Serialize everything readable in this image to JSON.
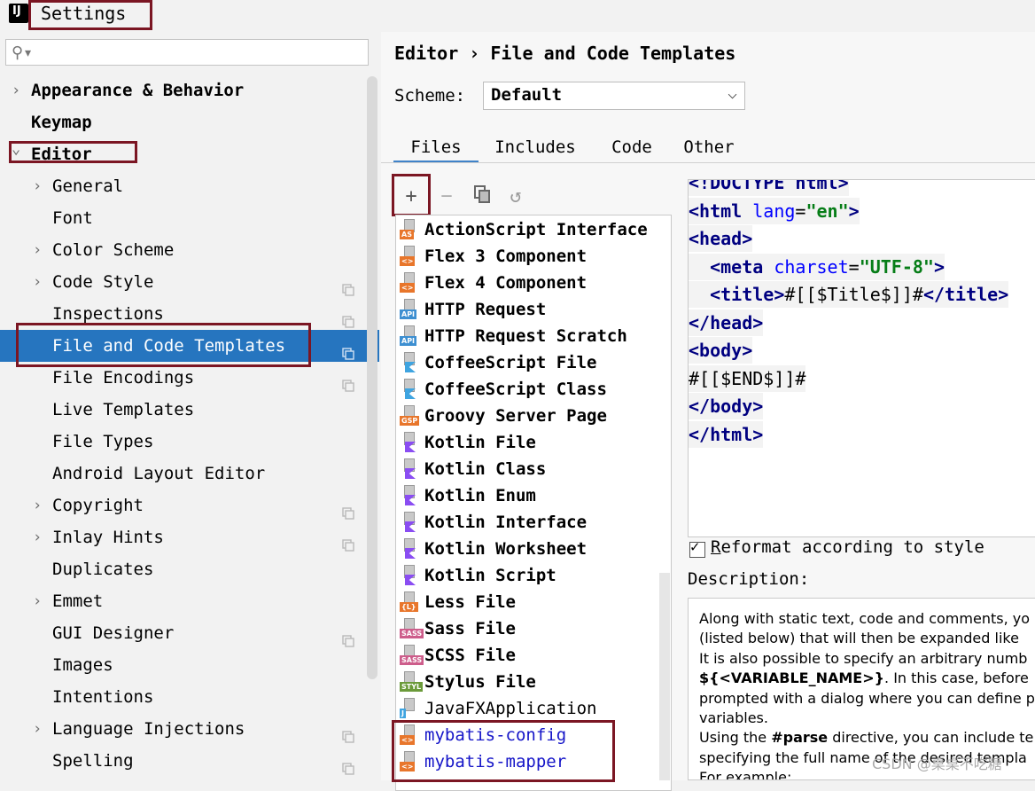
{
  "window": {
    "title": "Settings",
    "icon": "intellij-idea-icon"
  },
  "sidebar": {
    "search": {
      "placeholder": "",
      "icon": "search-icon"
    },
    "items": [
      {
        "label": "Appearance & Behavior",
        "expandable": true,
        "bold": true
      },
      {
        "label": "Keymap",
        "bold": true
      },
      {
        "label": "Editor",
        "expanded": true,
        "bold": true
      },
      {
        "label": "General",
        "expandable": true
      },
      {
        "label": "Font"
      },
      {
        "label": "Color Scheme",
        "expandable": true
      },
      {
        "label": "Code Style",
        "expandable": true,
        "project_icon": true
      },
      {
        "label": "Inspections",
        "project_icon": true
      },
      {
        "label": "File and Code Templates",
        "selected": true,
        "project_icon": true
      },
      {
        "label": "File Encodings",
        "project_icon": true
      },
      {
        "label": "Live Templates"
      },
      {
        "label": "File Types"
      },
      {
        "label": "Android Layout Editor"
      },
      {
        "label": "Copyright",
        "expandable": true,
        "project_icon": true
      },
      {
        "label": "Inlay Hints",
        "expandable": true,
        "project_icon": true
      },
      {
        "label": "Duplicates"
      },
      {
        "label": "Emmet",
        "expandable": true
      },
      {
        "label": "GUI Designer",
        "project_icon": true
      },
      {
        "label": "Images"
      },
      {
        "label": "Intentions"
      },
      {
        "label": "Language Injections",
        "expandable": true,
        "project_icon": true
      },
      {
        "label": "Spelling",
        "project_icon": true
      }
    ]
  },
  "main": {
    "breadcrumb": {
      "parent": "Editor",
      "separator": "›",
      "current": "File and Code Templates"
    },
    "scheme": {
      "label": "Scheme:",
      "value": "Default"
    },
    "tabs": [
      {
        "label": "Files",
        "active": true
      },
      {
        "label": "Includes"
      },
      {
        "label": "Code"
      },
      {
        "label": "Other"
      }
    ],
    "toolbar": {
      "add": "+",
      "remove": "−"
    },
    "templates": [
      {
        "name": "ActionScript Interface",
        "tag": "AS",
        "color": "#e8762b"
      },
      {
        "name": "Flex 3 Component",
        "tag": "<>",
        "color": "#e8762b"
      },
      {
        "name": "Flex 4 Component",
        "tag": "<>",
        "color": "#e8762b"
      },
      {
        "name": "HTTP Request",
        "tag": "API",
        "color": "#3d8fd1"
      },
      {
        "name": "HTTP Request Scratch",
        "tag": "API",
        "color": "#3d8fd1"
      },
      {
        "name": "CoffeeScript File",
        "tag": "",
        "color": "#3fa4e0"
      },
      {
        "name": "CoffeeScript Class",
        "tag": "",
        "color": "#3fa4e0"
      },
      {
        "name": "Groovy Server Page",
        "tag": "GSP",
        "color": "#e8762b"
      },
      {
        "name": "Kotlin File",
        "tag": "",
        "color": "#8a4df2"
      },
      {
        "name": "Kotlin Class",
        "tag": "",
        "color": "#8a4df2"
      },
      {
        "name": "Kotlin Enum",
        "tag": "",
        "color": "#8a4df2"
      },
      {
        "name": "Kotlin Interface",
        "tag": "",
        "color": "#8a4df2"
      },
      {
        "name": "Kotlin Worksheet",
        "tag": "",
        "color": "#8a4df2"
      },
      {
        "name": "Kotlin Script",
        "tag": "",
        "color": "#8a4df2"
      },
      {
        "name": "Less File",
        "tag": "{L}",
        "color": "#e8762b"
      },
      {
        "name": "Sass File",
        "tag": "SASS",
        "color": "#cd5d8b"
      },
      {
        "name": "SCSS File",
        "tag": "SASS",
        "color": "#cd5d8b"
      },
      {
        "name": "Stylus File",
        "tag": "STYL",
        "color": "#6b9a3a"
      },
      {
        "name": "JavaFXApplication",
        "tag": "J",
        "color": "#3fa4e0",
        "normal": true
      },
      {
        "name": "mybatis-config",
        "tag": "<>",
        "color": "#e8762b",
        "custom": true
      },
      {
        "name": "mybatis-mapper",
        "tag": "<>",
        "color": "#e8762b",
        "custom": true
      }
    ],
    "editor": {
      "lines": [
        [
          [
            "t",
            "<!DOCTYPE html>"
          ]
        ],
        [
          [
            "t",
            "<html "
          ],
          [
            "a",
            "lang"
          ],
          [
            "p",
            "="
          ],
          [
            "s",
            "\"en\""
          ],
          [
            "t",
            ">"
          ]
        ],
        [
          [
            "t",
            "<head>"
          ]
        ],
        [
          [
            "p",
            "  "
          ],
          [
            "t",
            "<meta "
          ],
          [
            "a",
            "charset"
          ],
          [
            "p",
            "="
          ],
          [
            "s",
            "\"UTF-8\""
          ],
          [
            "t",
            ">"
          ]
        ],
        [
          [
            "p",
            "  "
          ],
          [
            "t",
            "<title>"
          ],
          [
            "p",
            "#[[$Title$]]#"
          ],
          [
            "t",
            "</title>"
          ]
        ],
        [
          [
            "t",
            "</head>"
          ]
        ],
        [
          [
            "t",
            "<body>"
          ]
        ],
        [
          [
            "p",
            "#[[$END$]]#"
          ]
        ],
        [
          [
            "t",
            "</body>"
          ]
        ],
        [
          [
            "t",
            "</html>"
          ]
        ]
      ]
    },
    "reformat": {
      "checked": true,
      "label": "Reformat according to style"
    },
    "description": {
      "label": "Description:",
      "lines": [
        [
          [
            "n",
            "Along with static text, code and comments, yo"
          ]
        ],
        [
          [
            "n",
            "(listed below) that will then be expanded like"
          ]
        ],
        [
          [
            "n",
            "It is also possible to specify an arbitrary numb"
          ]
        ],
        [
          [
            "b",
            "${<VARIABLE_NAME>}"
          ],
          [
            "n",
            ". In this case, before"
          ]
        ],
        [
          [
            "n",
            "prompted with a dialog where you can define p"
          ]
        ],
        [
          [
            "n",
            "variables."
          ]
        ],
        [
          [
            "n",
            "Using the "
          ],
          [
            "b",
            "#parse"
          ],
          [
            "n",
            " directive, you can include te"
          ]
        ],
        [
          [
            "n",
            "specifying the full name of the desired templa"
          ]
        ],
        [
          [
            "n",
            "For example:"
          ]
        ]
      ]
    },
    "watermark": "CSDN @桌桌不吃糖"
  },
  "colors": {
    "selection": "#2675bf",
    "highlight_box": "#7b1623",
    "custom_template": "#1515c8",
    "tab_underline": "#4083c9"
  }
}
